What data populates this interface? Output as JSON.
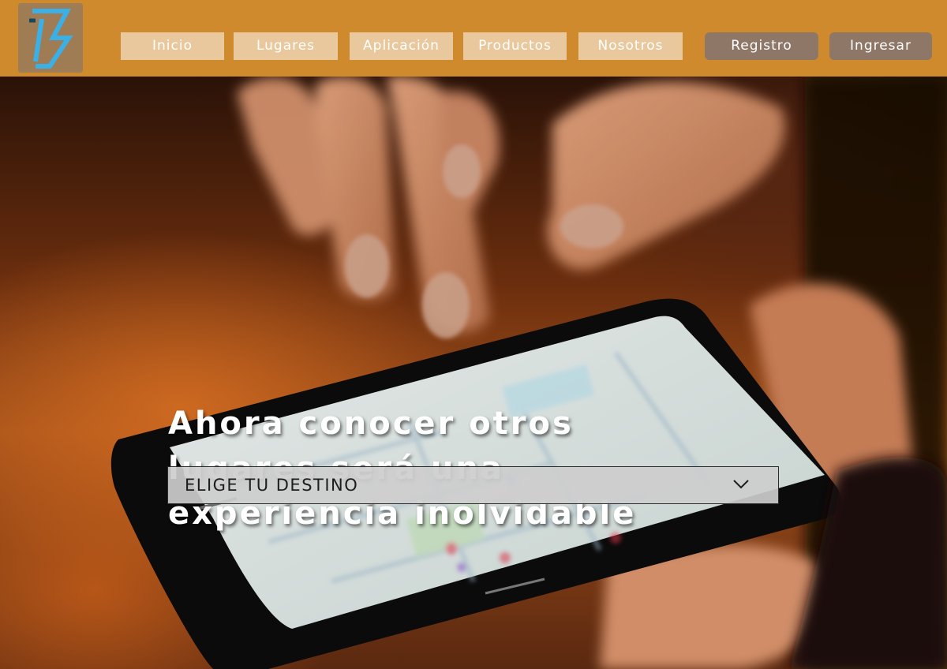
{
  "header": {
    "logo_icon": "stylized-b-logo-icon",
    "nav": [
      {
        "label": "Inicio"
      },
      {
        "label": "Lugares"
      },
      {
        "label": "Aplicación"
      },
      {
        "label": "Productos"
      },
      {
        "label": "Nosotros"
      }
    ],
    "register_label": "Registro",
    "login_label": "Ingresar"
  },
  "hero": {
    "headline_lines": [
      "Ahora conocer otros",
      "lugares será una",
      "experiencia inolvidable"
    ],
    "destination_select": {
      "selected": "ELIGE TU DESTINO",
      "icon": "chevron-down-icon"
    }
  },
  "colors": {
    "header_bg": "#d08a2e",
    "nav_button_bg": "#e9c89d",
    "auth_button_bg": "#8f7768",
    "logo_accent": "#3ab0e6"
  }
}
